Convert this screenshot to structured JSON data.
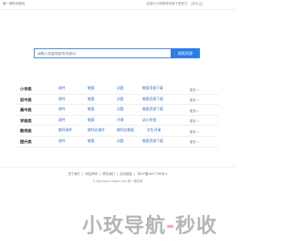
{
  "header": {
    "brand": "第一课件网首页",
    "links": [
      "全国中小学教师资源下载官方",
      "[设为主]"
    ]
  },
  "search": {
    "placeholder": "请输入您要搜索的关键词",
    "button_label": "搜索资源"
  },
  "categories": [
    {
      "name": "小学类",
      "links": [
        "课件",
        "教案",
        "试题",
        "教案资源下载"
      ],
      "more": "更多 >"
    },
    {
      "name": "初中类",
      "links": [
        "课件",
        "教案",
        "试题",
        "教案资源下载"
      ],
      "more": "更多 >"
    },
    {
      "name": "高中类",
      "links": [
        "课件",
        "教案",
        "试题",
        "教案资源下载"
      ],
      "more": "更多 >"
    },
    {
      "name": "学前类",
      "links": [
        "课件",
        "教案",
        "评课",
        "幼小衔接"
      ],
      "more": "更多 >"
    },
    {
      "name": "教师类",
      "links": [
        "教师课件",
        "教师总课件",
        "教师总教案",
        "学生评课"
      ],
      "more": "更多 >"
    },
    {
      "name": "提升类",
      "links": [
        "课件",
        "教案",
        "试题",
        "教案资源下载"
      ],
      "more": "更多 >"
    }
  ],
  "footer": {
    "links": [
      "关于我们",
      "网站声明",
      "联系我们",
      "友情链接",
      "粤ICP备16077756号-4"
    ],
    "copyright": "© http://www.1kejian.com  第一课件网"
  },
  "watermark": {
    "text_main": "小玫导航",
    "text_sep": "-",
    "text_tail": "秒收"
  },
  "colors": {
    "accent": "#2b7de9",
    "link": "#3a78c3"
  }
}
